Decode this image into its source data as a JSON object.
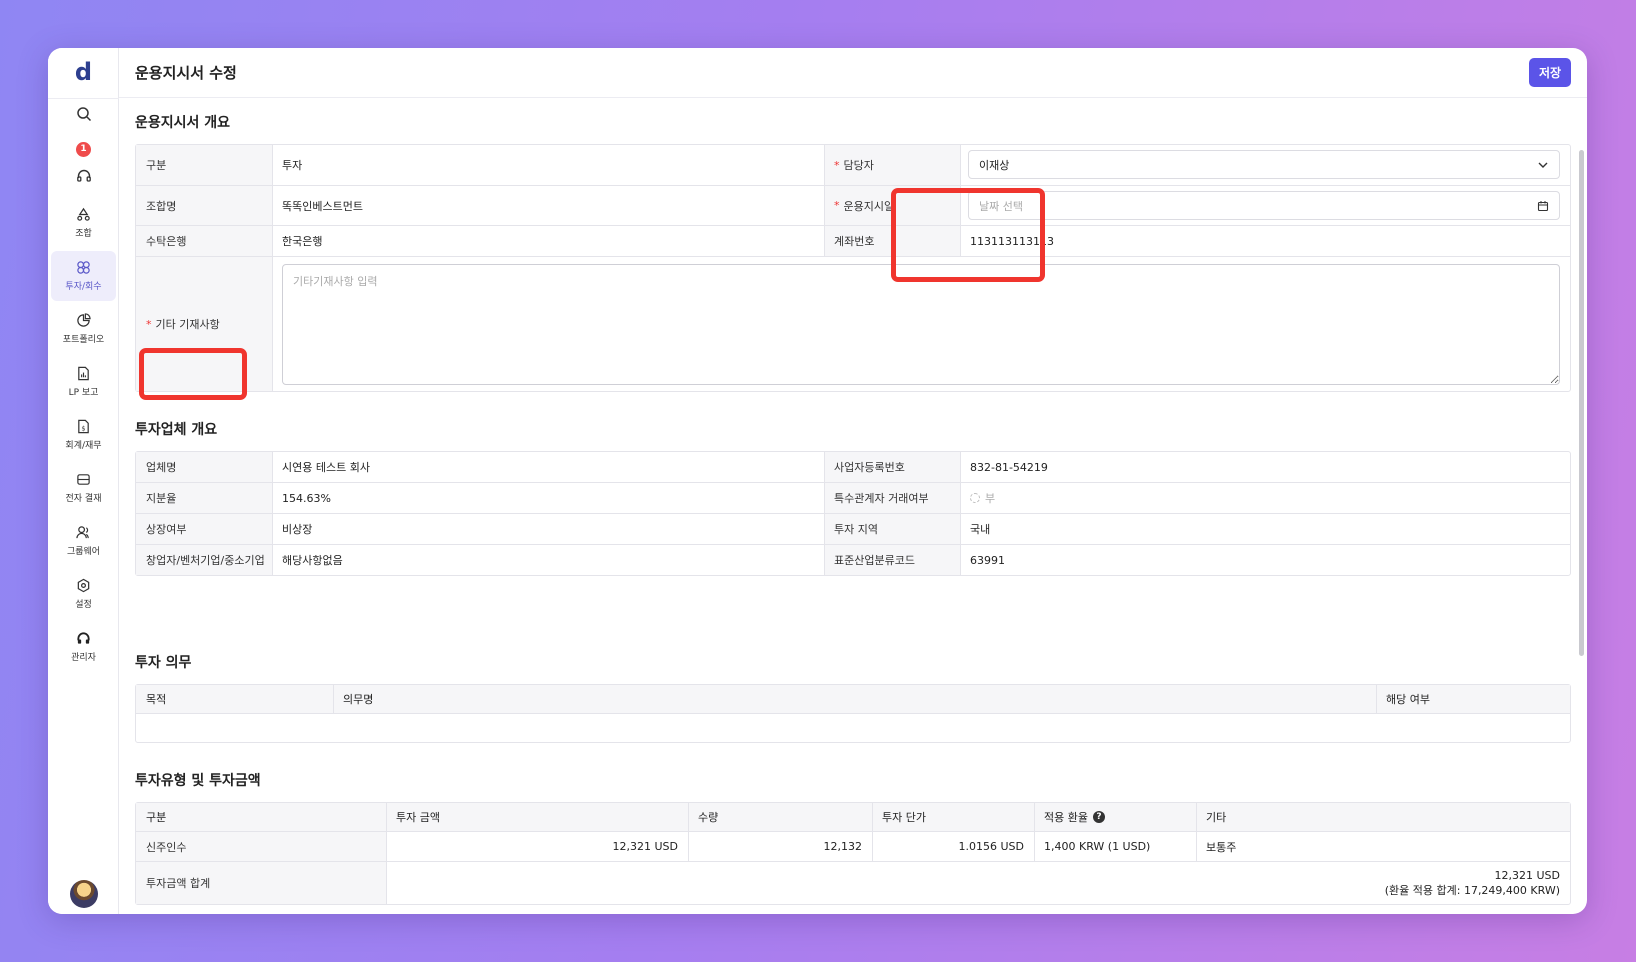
{
  "app": {
    "logo": "d"
  },
  "sidebar": {
    "badge_count": "1",
    "items": [
      {
        "label": "조합"
      },
      {
        "label": "투자/회수"
      },
      {
        "label": "포트폴리오"
      },
      {
        "label": "LP 보고"
      },
      {
        "label": "회계/재무"
      },
      {
        "label": "전자 결재"
      },
      {
        "label": "그룹웨어"
      },
      {
        "label": "설정"
      },
      {
        "label": "관리자"
      }
    ]
  },
  "header": {
    "title": "운용지시서 수정",
    "save_label": "저장"
  },
  "overview": {
    "title": "운용지시서 개요",
    "type_label": "구분",
    "type_value": "투자",
    "manager_label": "담당자",
    "manager_value": "이재상",
    "fund_label": "조합명",
    "fund_value": "똑똑인베스트먼트",
    "date_label": "운용지시일",
    "date_placeholder": "날짜 선택",
    "bank_label": "수탁은행",
    "bank_value": "한국은행",
    "account_label": "계좌번호",
    "account_value": "113113113113",
    "notes_label": "기타 기재사항",
    "notes_placeholder": "기타기재사항 입력"
  },
  "company": {
    "title": "투자업체 개요",
    "name_label": "업체명",
    "name_value": "시연용 테스트 회사",
    "bizno_label": "사업자등록번호",
    "bizno_value": "832-81-54219",
    "share_label": "지분율",
    "share_value": "154.63%",
    "related_label": "특수관계자 거래여부",
    "related_value": "부",
    "listed_label": "상장여부",
    "listed_value": "비상장",
    "region_label": "투자 지역",
    "region_value": "국내",
    "venture_label": "창업자/벤처기업/중소기업",
    "venture_value": "해당사항없음",
    "industry_label": "표준산업분류코드",
    "industry_value": "63991"
  },
  "duty": {
    "title": "투자 의무",
    "col_purpose": "목적",
    "col_name": "의무명",
    "col_applicable": "해당 여부"
  },
  "amount": {
    "title": "투자유형 및 투자금액",
    "headers": {
      "type": "구분",
      "amount": "투자 금액",
      "qty": "수량",
      "price": "투자 단가",
      "rate": "적용 환율",
      "etc": "기타"
    },
    "row": {
      "type": "신주인수",
      "amount": "12,321 USD",
      "qty": "12,132",
      "price": "1.0156 USD",
      "rate": "1,400 KRW (1 USD)",
      "etc": "보통주"
    },
    "total_label": "투자금액 합계",
    "total_value": "12,321 USD",
    "total_krw": "(환율 적용 합계: 17,249,400 KRW)"
  }
}
